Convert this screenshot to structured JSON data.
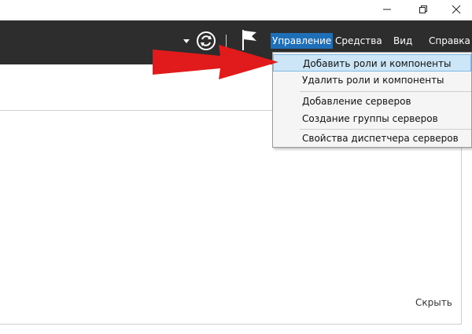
{
  "window_controls": {
    "minimize_icon": "minimize-icon",
    "maximize_icon": "restore-icon",
    "close_icon": "close-icon"
  },
  "toolbar": {
    "menus": [
      "Управление",
      "Средства",
      "Вид",
      "Справка"
    ],
    "active_menu": "Управление",
    "accent_color": "#1e6fb8"
  },
  "dropdown": {
    "items": [
      "Добавить роли и компоненты",
      "Удалить роли и компоненты",
      "Добавление серверов",
      "Создание группы серверов",
      "Свойства диспетчера серверов"
    ],
    "highlighted": "Добавить роли и компоненты"
  },
  "content": {
    "hide_link": "Скрыть"
  },
  "annotation": {
    "arrow_color": "#e11b1b"
  }
}
